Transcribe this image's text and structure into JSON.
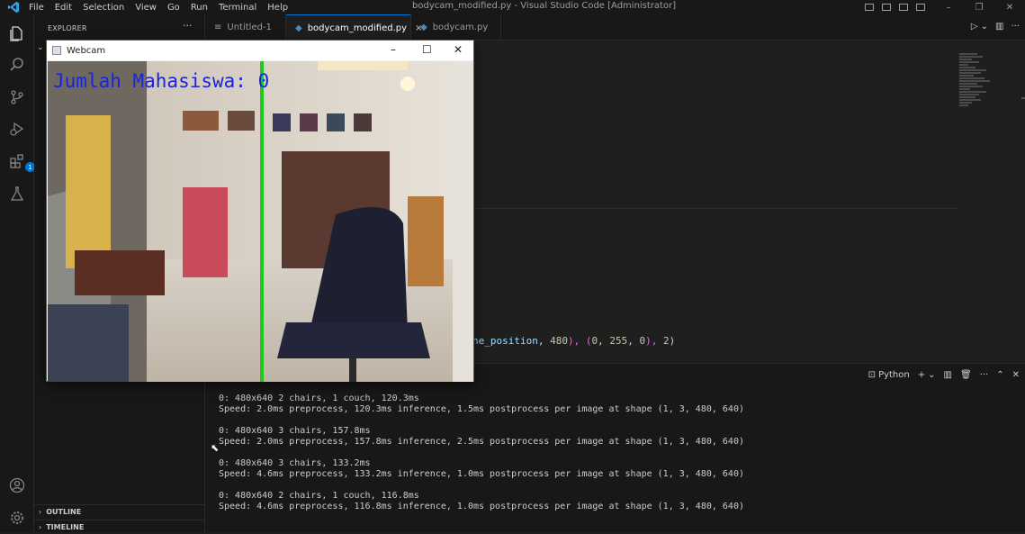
{
  "titlebar": {
    "menu": [
      "File",
      "Edit",
      "Selection",
      "View",
      "Go",
      "Run",
      "Terminal",
      "Help"
    ],
    "window_title": "bodycam_modified.py - Visual Studio Code [Administrator]",
    "controls": [
      "–",
      "❐",
      "✕"
    ]
  },
  "activitybar": {
    "items": [
      "files-icon",
      "search-icon",
      "source-control-icon",
      "run-debug-icon",
      "extensions-icon",
      "testing-icon",
      "account-icon",
      "settings-gear-icon"
    ],
    "extensions_badge": "1"
  },
  "sidebar": {
    "title": "EXPLORER",
    "more": "···",
    "sections": [
      "OUTLINE",
      "TIMELINE"
    ]
  },
  "tabs": [
    {
      "label": "Untitled-1",
      "icon": "≡",
      "active": false
    },
    {
      "label": "bodycam_modified.py",
      "icon": "python-icon",
      "active": true,
      "close": "×"
    },
    {
      "label": "bodycam.py",
      "icon": "python-icon",
      "active": false
    }
  ],
  "editor": {
    "code_parts": [
      {
        "t": "ne_position",
        "c": "var"
      },
      {
        "t": ", ",
        "c": "pun"
      },
      {
        "t": "480",
        "c": "num"
      },
      {
        "t": "), (",
        "c": "br"
      },
      {
        "t": "0",
        "c": "num"
      },
      {
        "t": ", ",
        "c": "pun"
      },
      {
        "t": "255",
        "c": "num"
      },
      {
        "t": ", ",
        "c": "pun"
      },
      {
        "t": "0",
        "c": "num"
      },
      {
        "t": "), ",
        "c": "br"
      },
      {
        "t": "2",
        "c": "num"
      },
      {
        "t": ")",
        "c": "pun"
      }
    ]
  },
  "panel": {
    "shell_label": "Python",
    "terminal_lines": [
      "0: 480x640 2 chairs, 1 couch, 120.3ms",
      "Speed: 2.0ms preprocess, 120.3ms inference, 1.5ms postprocess per image at shape (1, 3, 480, 640)",
      "",
      "0: 480x640 3 chairs, 157.8ms",
      "Speed: 2.0ms preprocess, 157.8ms inference, 2.5ms postprocess per image at shape (1, 3, 480, 640)",
      "",
      "0: 480x640 3 chairs, 133.2ms",
      "Speed: 4.6ms preprocess, 133.2ms inference, 1.0ms postprocess per image at shape (1, 3, 480, 640)",
      "",
      "0: 480x640 2 chairs, 1 couch, 116.8ms",
      "Speed: 4.6ms preprocess, 116.8ms inference, 1.0ms postprocess per image at shape (1, 3, 480, 640)"
    ]
  },
  "webcam": {
    "title": "Webcam",
    "overlay": "Jumlah Mahasiswa: 0",
    "line_color": "#1ec81e",
    "text_color": "#1b24d8"
  }
}
